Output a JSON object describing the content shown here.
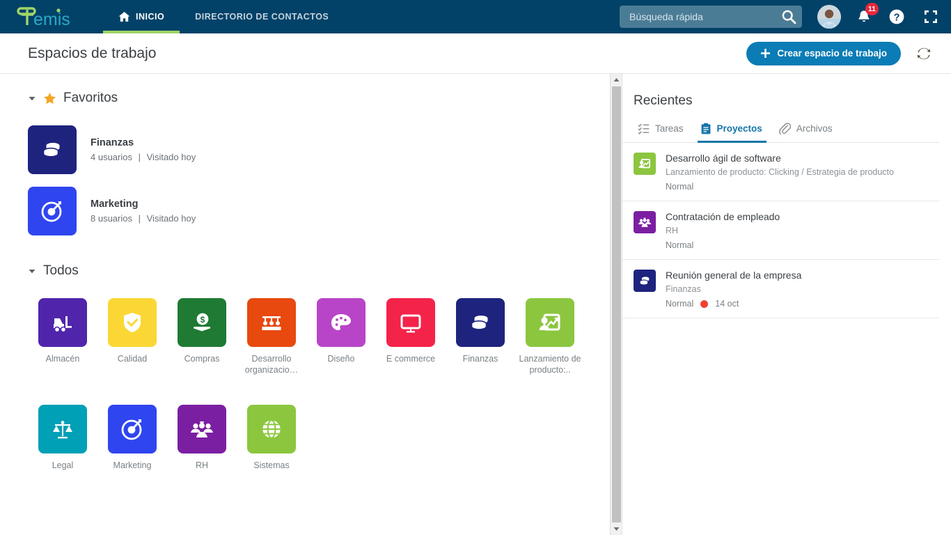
{
  "brand": {
    "logo_text": "Temis",
    "logo_green": "#a0d468",
    "logo_teal": "#2aa9c4",
    "nav_bg": "#034268",
    "accent_blue": "#0b7cb5"
  },
  "topnav": {
    "items": [
      {
        "label": "INICIO",
        "icon": "home-icon",
        "active": true
      },
      {
        "label": "DIRECTORIO DE CONTACTOS",
        "icon": "",
        "active": false
      }
    ],
    "search": {
      "placeholder": "Búsqueda rápida",
      "value": "",
      "icon": "search-icon"
    },
    "avatar_name": "user-avatar",
    "notifications": {
      "count": "11",
      "icon": "bell-icon"
    },
    "help_icon": "help-circle-icon",
    "expand_icon": "fullscreen-icon"
  },
  "page_header": {
    "title": "Espacios de trabajo",
    "create_button": {
      "label": "Crear espacio de trabajo",
      "icon": "plus-icon"
    },
    "refresh_icon": "refresh-icon"
  },
  "favorites_section": {
    "title": "Favoritos",
    "caret": "caret-down-icon",
    "star": "star-icon",
    "items": [
      {
        "name": "Finanzas",
        "users": "4 usuarios",
        "visited": "Visitado hoy",
        "separator": "|",
        "color": "#1e237e",
        "icon": "coins-icon"
      },
      {
        "name": "Marketing",
        "users": "8 usuarios",
        "visited": "Visitado hoy",
        "separator": "|",
        "color": "#2f45f0",
        "icon": "target-icon"
      }
    ]
  },
  "all_section": {
    "title": "Todos",
    "caret": "caret-down-icon",
    "items": [
      {
        "label": "Almacén",
        "color": "#5025ac",
        "icon": "forklift-icon"
      },
      {
        "label": "Calidad",
        "color": "#fbd736",
        "icon": "shield-check-icon"
      },
      {
        "label": "Compras",
        "color": "#1f7a34",
        "icon": "money-hand-icon"
      },
      {
        "label": "Desarrollo organizacio…",
        "color": "#e8490f",
        "icon": "org-people-icon"
      },
      {
        "label": "Diseño",
        "color": "#b845c8",
        "icon": "palette-icon"
      },
      {
        "label": "E commerce",
        "color": "#f4234a",
        "icon": "monitor-icon"
      },
      {
        "label": "Finanzas",
        "color": "#1e237e",
        "icon": "coins-icon"
      },
      {
        "label": "Lanzamiento de producto:..",
        "color": "#8cc63f",
        "icon": "launch-chart-icon"
      },
      {
        "label": "Legal",
        "color": "#00a0b7",
        "icon": "scales-icon"
      },
      {
        "label": "Marketing",
        "color": "#2f45f0",
        "icon": "target-icon"
      },
      {
        "label": "RH",
        "color": "#7b1fa2",
        "icon": "people-group-icon"
      },
      {
        "label": "Sistemas",
        "color": "#8cc63f",
        "icon": "globe-icon"
      }
    ]
  },
  "recent_panel": {
    "title": "Recientes",
    "tabs": [
      {
        "label": "Tareas",
        "icon": "checklist-icon",
        "active": false
      },
      {
        "label": "Proyectos",
        "icon": "clipboard-icon",
        "active": true
      },
      {
        "label": "Archivos",
        "icon": "paperclip-icon",
        "active": false
      }
    ],
    "projects": [
      {
        "title": "Desarrollo ágil de software",
        "subtitle": "Lanzamiento de producto: Clicking / Estrategia de producto",
        "status": "Normal",
        "date": "",
        "has_dot": false,
        "color": "#8cc63f",
        "icon": "launch-chart-icon"
      },
      {
        "title": "Contratación de empleado",
        "subtitle": "RH",
        "status": "Normal",
        "date": "",
        "has_dot": false,
        "color": "#7b1fa2",
        "icon": "people-group-icon"
      },
      {
        "title": "Reunión general de la empresa",
        "subtitle": "Finanzas",
        "status": "Normal",
        "date": "14 oct",
        "has_dot": true,
        "dot_color": "#f2412f",
        "color": "#1e237e",
        "icon": "coins-icon"
      }
    ]
  },
  "scrollbar": {
    "up_arrow": "caret-up-icon",
    "down_arrow": "caret-down-icon"
  }
}
